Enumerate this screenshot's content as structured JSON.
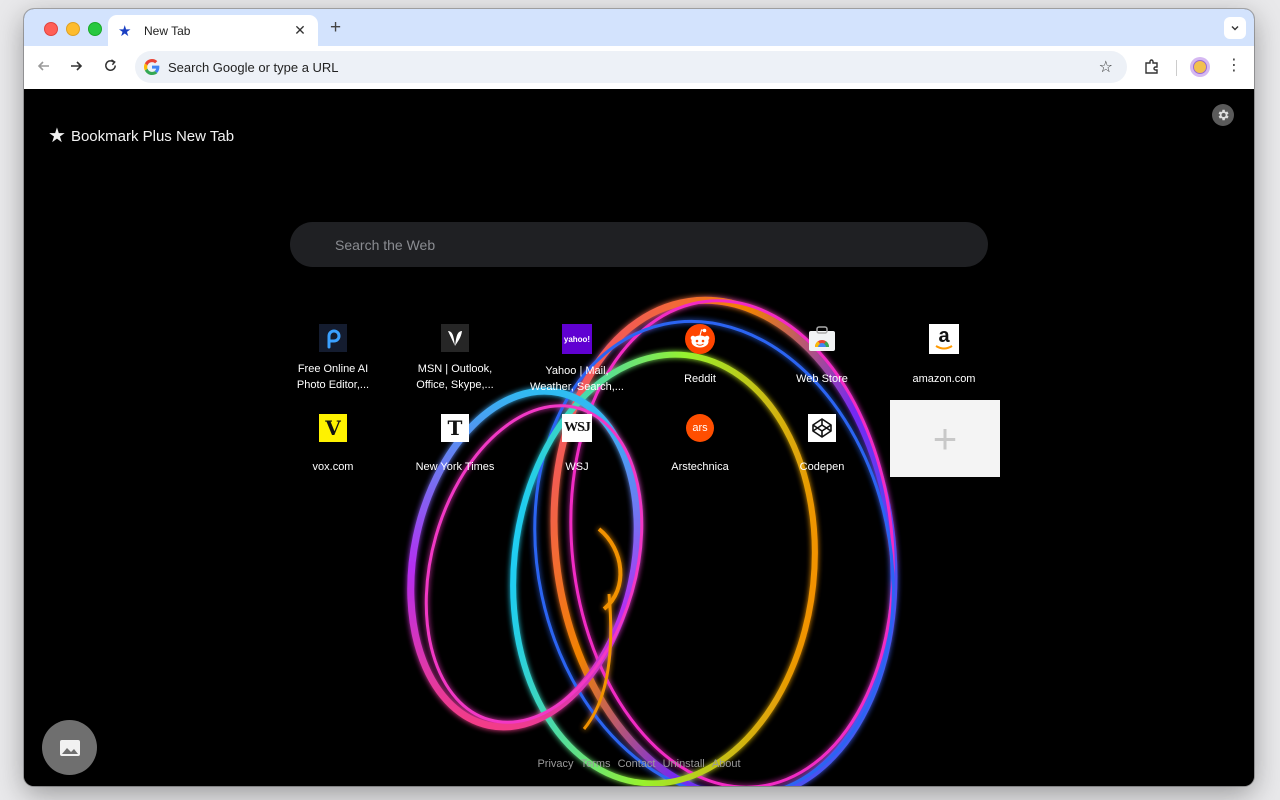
{
  "browser": {
    "tab": {
      "title": "New Tab"
    },
    "omnibox": {
      "placeholder": "Search Google or type a URL"
    }
  },
  "page": {
    "brand": "Bookmark Plus New Tab",
    "search": {
      "placeholder": "Search the Web"
    },
    "shortcuts": [
      {
        "name": "pixlr",
        "label": "Free Online AI Photo Editor,..."
      },
      {
        "name": "msn",
        "label": "MSN | Outlook, Office, Skype,..."
      },
      {
        "name": "yahoo",
        "label": "Yahoo | Mail, Weather, Search,..."
      },
      {
        "name": "reddit",
        "label": "Reddit"
      },
      {
        "name": "web-store",
        "label": "Web Store"
      },
      {
        "name": "amazon",
        "label": "amazon.com"
      },
      {
        "name": "vox",
        "label": "vox.com"
      },
      {
        "name": "nytimes",
        "label": "New York Times"
      },
      {
        "name": "wsj",
        "label": "WSJ"
      },
      {
        "name": "arstechnica",
        "label": "Arstechnica"
      },
      {
        "name": "codepen",
        "label": "Codepen"
      }
    ],
    "icon_text": {
      "yahoo": "yahoo!",
      "vox": "V",
      "nytimes": "T",
      "wsj": "WSJ",
      "ars": "ars",
      "amazon": "a"
    },
    "footer": [
      "Privacy",
      "Terms",
      "Contact",
      "Uninstall",
      "About"
    ]
  }
}
